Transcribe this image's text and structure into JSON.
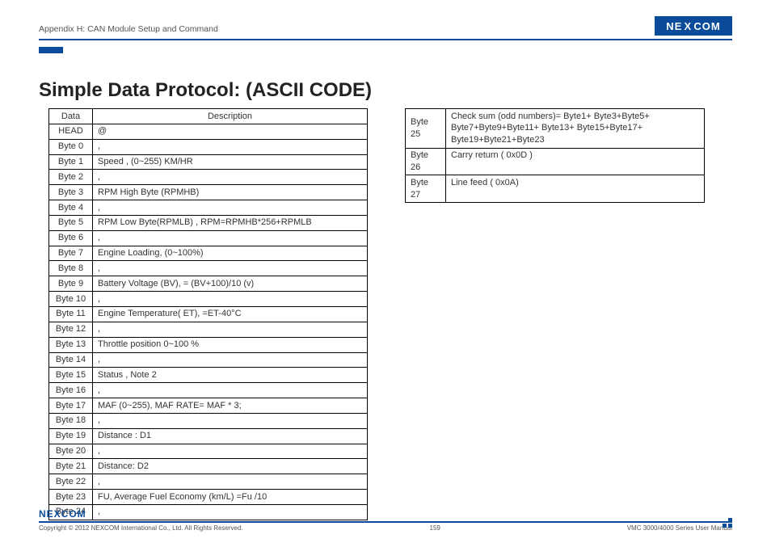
{
  "header": {
    "appendix": "Appendix H: CAN Module Setup and Command",
    "logo_text": "NE",
    "logo_text2": "COM",
    "logo_x": "X"
  },
  "title": "Simple Data Protocol: (ASCII CODE)",
  "table1": {
    "headers": [
      "Data",
      "Description"
    ],
    "rows": [
      [
        "HEAD",
        "@"
      ],
      [
        "Byte 0",
        ","
      ],
      [
        "Byte 1",
        "Speed , (0~255) KM/HR"
      ],
      [
        "Byte 2",
        ","
      ],
      [
        "Byte 3",
        "RPM High Byte (RPMHB)"
      ],
      [
        "Byte 4",
        ","
      ],
      [
        "Byte 5",
        "RPM Low Byte(RPMLB) , RPM=RPMHB*256+RPMLB"
      ],
      [
        "Byte 6",
        ","
      ],
      [
        "Byte 7",
        "Engine Loading, (0~100%)"
      ],
      [
        "Byte 8",
        ","
      ],
      [
        "Byte 9",
        "Battery Voltage (BV), = (BV+100)/10 (v)"
      ],
      [
        "Byte 10",
        ","
      ],
      [
        "Byte 11",
        "Engine Temperature( ET), =ET-40°C"
      ],
      [
        "Byte 12",
        ","
      ],
      [
        "Byte 13",
        "Throttle position 0~100 %"
      ],
      [
        "Byte 14",
        ","
      ],
      [
        "Byte 15",
        "Status , Note 2"
      ],
      [
        "Byte 16",
        ","
      ],
      [
        "Byte 17",
        "MAF (0~255), MAF RATE= MAF * 3;"
      ],
      [
        "Byte 18",
        ","
      ],
      [
        "Byte 19",
        "Distance : D1"
      ],
      [
        "Byte 20",
        ","
      ],
      [
        "Byte 21",
        "Distance: D2"
      ],
      [
        "Byte 22",
        ","
      ],
      [
        "Byte 23",
        "FU, Average Fuel Economy (km/L) =Fu /10"
      ],
      [
        "Byte 24",
        ","
      ]
    ]
  },
  "table2": {
    "rows": [
      [
        "Byte 25",
        "Check sum (odd numbers)= Byte1+ Byte3+Byte5+ Byte7+Byte9+Byte11+ Byte13+ Byte15+Byte17+ Byte19+Byte21+Byte23"
      ],
      [
        "Byte 26",
        "Carry return ( 0x0D )"
      ],
      [
        "Byte 27",
        "Line feed ( 0x0A)"
      ]
    ]
  },
  "footer": {
    "logo": "NEXCOM",
    "copyright": "Copyright © 2012 NEXCOM International Co., Ltd. All Rights Reserved.",
    "page": "159",
    "manual": "VMC 3000/4000 Series User Manual"
  }
}
